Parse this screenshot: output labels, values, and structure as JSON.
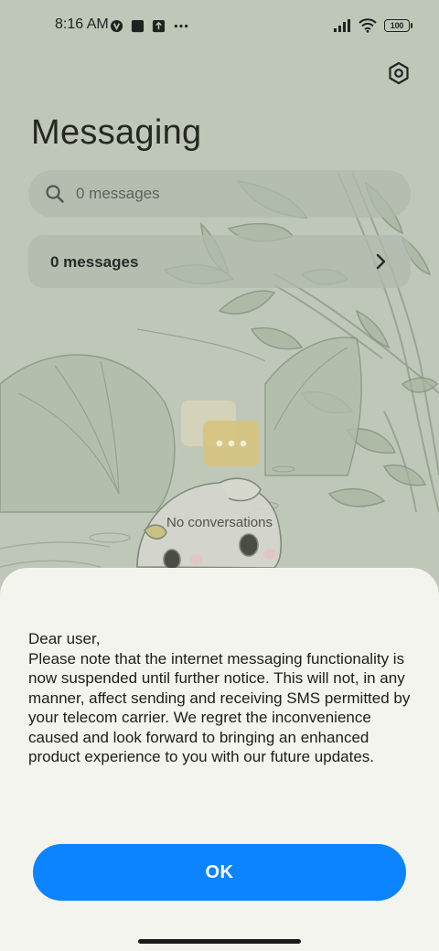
{
  "status_bar": {
    "time": "8:16 AM",
    "battery_level": "100",
    "left_icons": [
      "vpn-icon",
      "notification-square-icon",
      "upload-icon",
      "more-dots-icon"
    ],
    "right_icons": [
      "signal-icon",
      "wifi-icon",
      "battery-icon"
    ]
  },
  "header": {
    "title": "Messaging",
    "settings_icon": "gear-icon"
  },
  "search": {
    "placeholder": "0 messages",
    "icon": "search-icon"
  },
  "messages_card": {
    "label": "0 messages",
    "icon": "chevron-right-icon"
  },
  "empty_state": {
    "text": "No conversations",
    "icon": "chat-bubble-icon"
  },
  "dialog": {
    "greeting": "Dear user,",
    "body": "Please note that the internet messaging functionality is now suspended until further notice. This will not, in any manner, affect sending and receiving SMS permitted by your telecom carrier. We regret the inconvenience caused and look forward to bringing an enhanced product experience to you with our future updates.",
    "ok_label": "OK"
  },
  "colors": {
    "accent": "#0d84ff",
    "sheet_background": "#f4f4ee",
    "backdrop": "#bfc7b9"
  }
}
